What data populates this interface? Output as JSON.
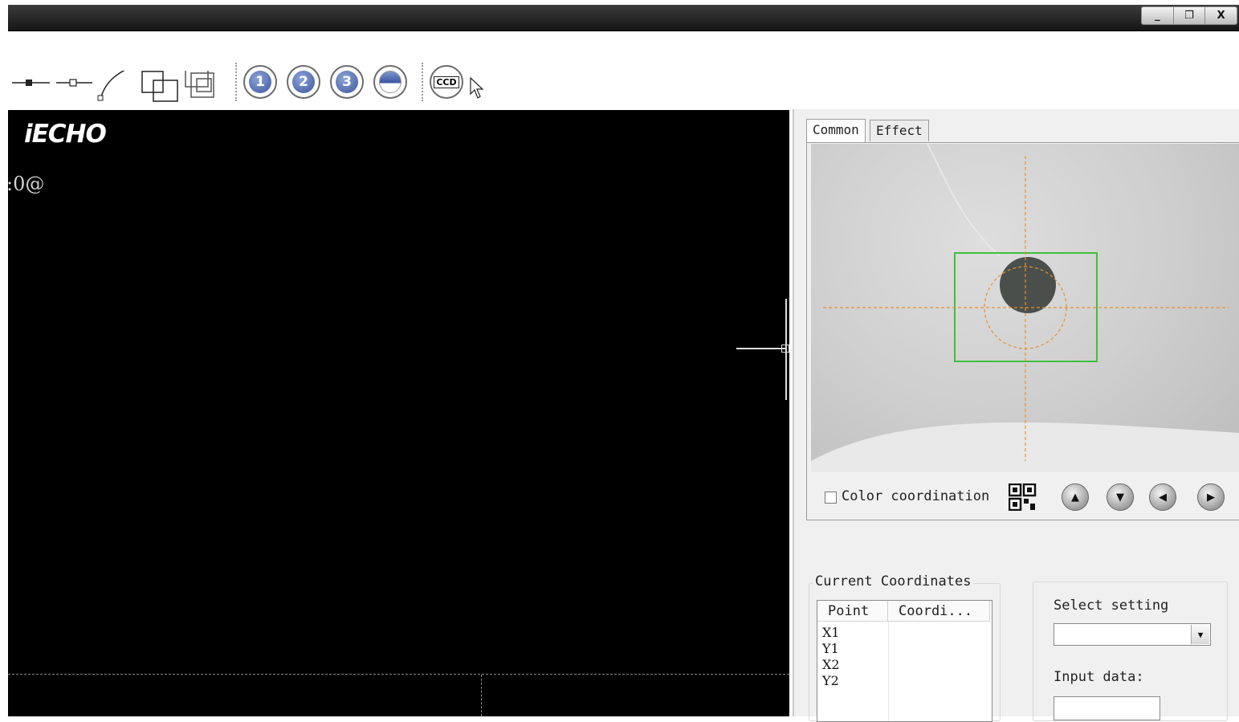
{
  "window": {
    "controls": [
      "_",
      "❐",
      "X"
    ]
  },
  "toolbar": {
    "number_buttons": [
      "1",
      "2",
      "3"
    ],
    "ccd_label": "CCD"
  },
  "canvas": {
    "logo": "iECHO",
    "command_text": ":0@"
  },
  "panel": {
    "tabs": [
      "Common",
      "Effect"
    ],
    "active_tab": "Common",
    "color_coordination_label": "Color coordination",
    "color_coordination_checked": false,
    "nav_buttons": [
      "up-icon",
      "down-icon",
      "left-icon",
      "right-icon"
    ],
    "current_coordinates": {
      "title": "Current Coordinates",
      "columns": [
        "Point",
        "Coordi..."
      ],
      "rows": [
        "X1",
        "Y1",
        "X2",
        "Y2"
      ]
    },
    "select_setting_label": "Select setting",
    "select_setting_value": "",
    "input_data_label": "Input data:",
    "input_data_value": ""
  },
  "colors": {
    "canvas_bg": "#000000",
    "target_box": "#3fbf3f",
    "crosshair": "#e8902a"
  }
}
